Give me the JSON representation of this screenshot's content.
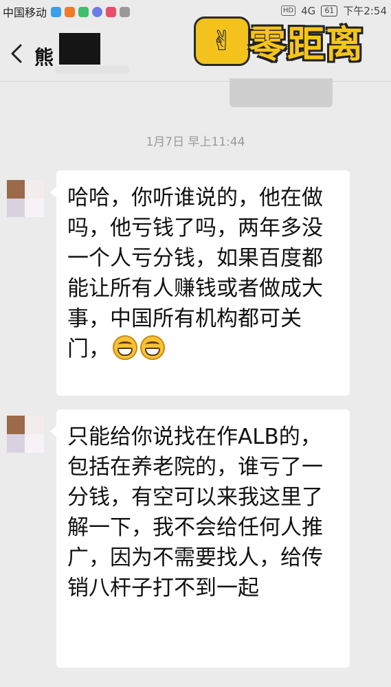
{
  "status_bar": {
    "carrier": "中国移动",
    "hd_badge": "HD",
    "network": "4G",
    "battery": "61",
    "time": "下午2:54"
  },
  "header": {
    "contact_name_visible": "熊"
  },
  "watermark": {
    "logo_text": "零距离"
  },
  "chat": {
    "timestamp": "1月7日 早上11:44",
    "messages": [
      {
        "sender": "contact",
        "text": "哈哈，你听谁说的，他在做吗，他亏钱了吗，两年多没一个人亏分钱，如果百度都能让所有人赚钱或者做成大事，中国所有机构都可关门，",
        "emoji_count": 2,
        "emoji_name": "grin-emoji"
      },
      {
        "sender": "contact",
        "text": "只能给你说找在作ALB的，包括在养老院的，谁亏了一分钱，有空可以来我这里了解一下，我不会给任何人推广，因为不需要找人，给传销八杆子打不到一起"
      }
    ]
  },
  "colors": {
    "background": "#ebebeb",
    "bubble": "#ffffff",
    "timestamp": "#9a9a9a",
    "logo_yellow": "#f6c51b"
  }
}
